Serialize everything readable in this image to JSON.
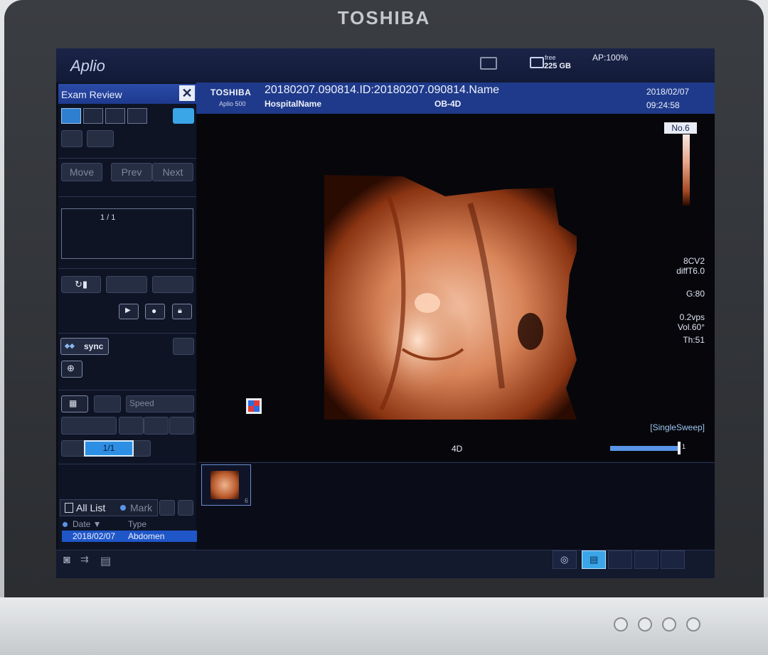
{
  "device": {
    "brand": "TOSHIBA"
  },
  "topbar": {
    "app_name": "Aplio",
    "free_label": "free",
    "free_value": "225 GB",
    "ap_power": "AP:100%"
  },
  "left_panel": {
    "title": "Exam Review",
    "close_icon": "close-icon",
    "move_label": "Move",
    "prev_label": "Prev",
    "next_label": "Next",
    "page_indicator": "1 / 1",
    "sync_label": "sync",
    "speed_label": "Speed",
    "frame_value": "1/1",
    "list_all_label": "All List",
    "mark_label": "Mark",
    "columns": [
      "Date ▼",
      "Type"
    ],
    "rows": [
      {
        "date": "2018/02/07",
        "type": "Abdomen"
      }
    ]
  },
  "header": {
    "logo": "TOSHIBA",
    "model": "Aplio 500",
    "exam_title": "20180207.090814.ID:20180207.090814.Name",
    "hospital": "HospitalName",
    "mode": "OB-4D",
    "date": "2018/02/07",
    "time": "09:24:58"
  },
  "image_area": {
    "colorbar_label": "No.6",
    "probe": "8CV2",
    "freq": "diffT6.0",
    "gain": "G:80",
    "rate": "0.2vps",
    "volume": "Vol.60°",
    "thickness": "Th:51",
    "sweep_mode": "[SingleSweep]",
    "mode_label": "4D",
    "slider_end": "1"
  },
  "thumbnails": [
    {
      "label": "6"
    }
  ]
}
